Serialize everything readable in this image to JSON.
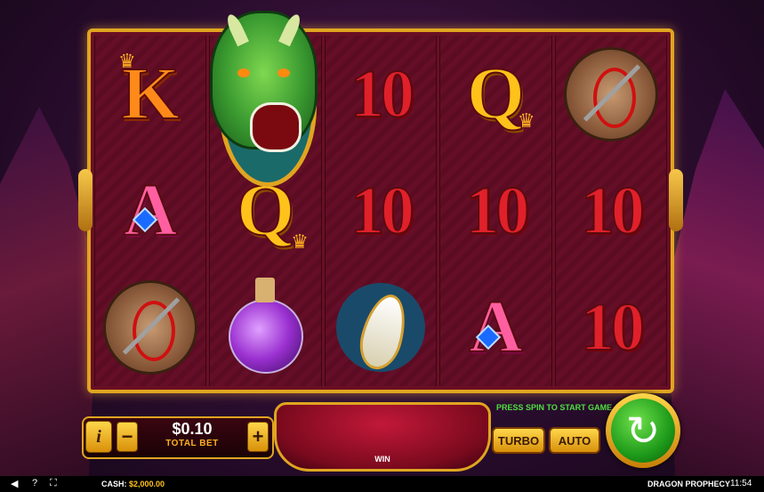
{
  "reels": [
    [
      "K",
      "A",
      "shield"
    ],
    [
      "dragon",
      "Q",
      "potion"
    ],
    [
      "10",
      "10",
      "horn"
    ],
    [
      "Q",
      "10",
      "A"
    ],
    [
      "shield",
      "10",
      "10"
    ]
  ],
  "controls": {
    "info_label": "i",
    "minus_label": "−",
    "plus_label": "+",
    "bet_value": "$0.10",
    "bet_label": "TOTAL BET",
    "win_label": "WIN",
    "hint": "PRESS SPIN TO START GAME",
    "turbo_label": "TURBO",
    "auto_label": "AUTO",
    "spin_icon": "↻"
  },
  "status_bar": {
    "cash_label": "CASH:",
    "cash_value": "$2,000.00",
    "game_title": "DRAGON PROPHECY",
    "clock": "11:54",
    "icons": [
      "speaker-icon",
      "help-icon",
      "fullscreen-icon"
    ],
    "speaker_glyph": "◀",
    "help_glyph": "?",
    "fullscreen_glyph": "⛶"
  },
  "colors": {
    "frame_gold": "#e0a520",
    "spin_green": "#1e9a1a",
    "hint_green": "#50e040"
  }
}
